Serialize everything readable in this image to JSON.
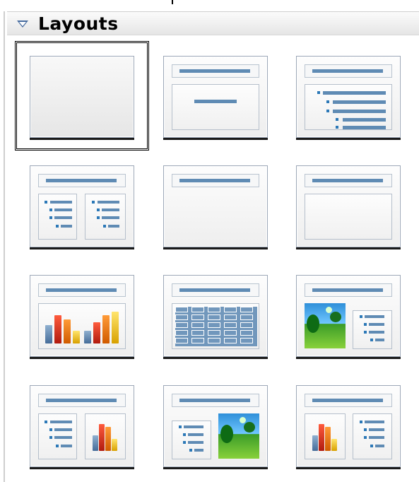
{
  "panel": {
    "title": "Layouts",
    "selected_layout": "blank-slide"
  },
  "icons": {
    "expander": "triangle-down-icon"
  },
  "layouts": [
    {
      "name": "blank-slide",
      "type": "blank"
    },
    {
      "name": "title-content",
      "type": "title-content"
    },
    {
      "name": "title-outline",
      "type": "title-outline"
    },
    {
      "name": "title-two-outlines",
      "type": "title-two-outlines"
    },
    {
      "name": "title-only",
      "type": "title-only"
    },
    {
      "name": "title-box",
      "type": "title-box"
    },
    {
      "name": "title-chart",
      "type": "title-chart"
    },
    {
      "name": "title-table",
      "type": "title-table"
    },
    {
      "name": "title-image-outline",
      "type": "title-image-outline"
    },
    {
      "name": "title-outline-chart",
      "type": "title-outline-chart"
    },
    {
      "name": "title-outline-image",
      "type": "title-outline-image"
    },
    {
      "name": "title-chart-outline",
      "type": "title-chart-outline"
    }
  ],
  "colors": {
    "accent": "#5f8bb4",
    "header": "#e5e5e5",
    "selection": "#000000"
  }
}
